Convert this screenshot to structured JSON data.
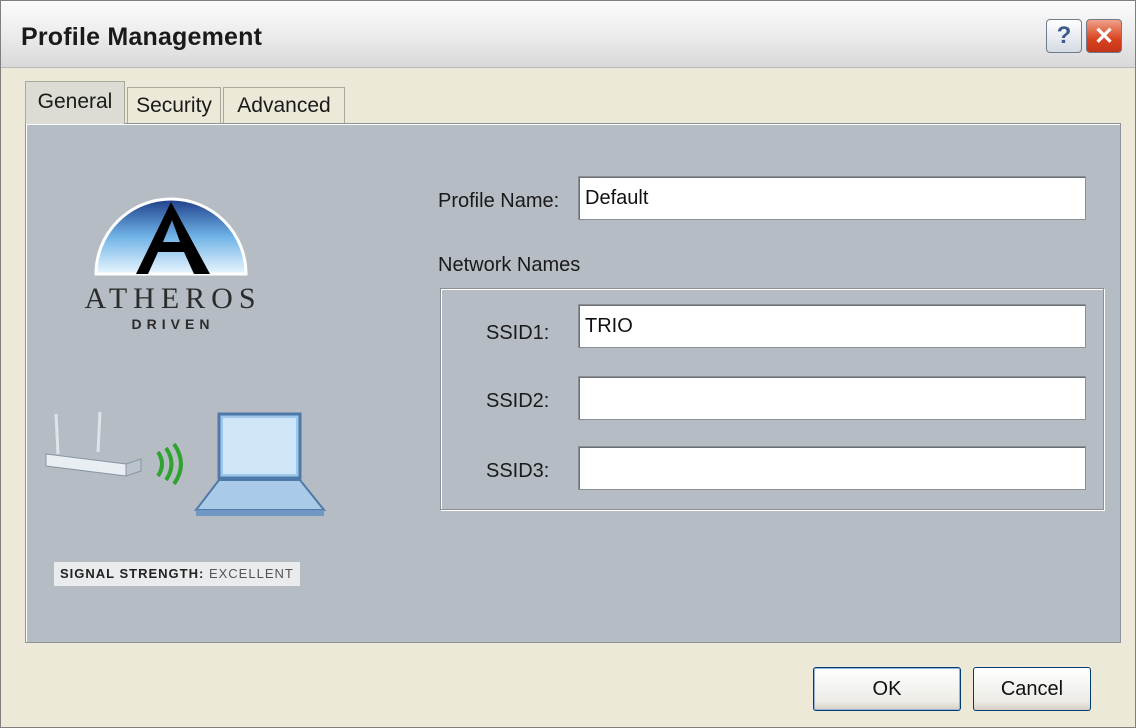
{
  "window": {
    "title": "Profile Management",
    "help_label": "?",
    "close_label": "✕"
  },
  "tabs": [
    {
      "label": "General",
      "active": true
    },
    {
      "label": "Security",
      "active": false
    },
    {
      "label": "Advanced",
      "active": false
    }
  ],
  "brand": {
    "line1": "ATHEROS",
    "line2": "DRIVEN",
    "signal_label": "SIGNAL STRENGTH:",
    "signal_value": "EXCELLENT"
  },
  "form": {
    "profile_name_label": "Profile Name:",
    "profile_name_value": "Default",
    "network_names_label": "Network Names",
    "ssid1_label": "SSID1:",
    "ssid1_value": "TRIO",
    "ssid2_label": "SSID2:",
    "ssid2_value": "",
    "ssid3_label": "SSID3:",
    "ssid3_value": ""
  },
  "buttons": {
    "ok": "OK",
    "cancel": "Cancel"
  },
  "colors": {
    "panel": "#b5bcc3",
    "window": "#ece9d8",
    "signal_green": "#2fa32f"
  }
}
